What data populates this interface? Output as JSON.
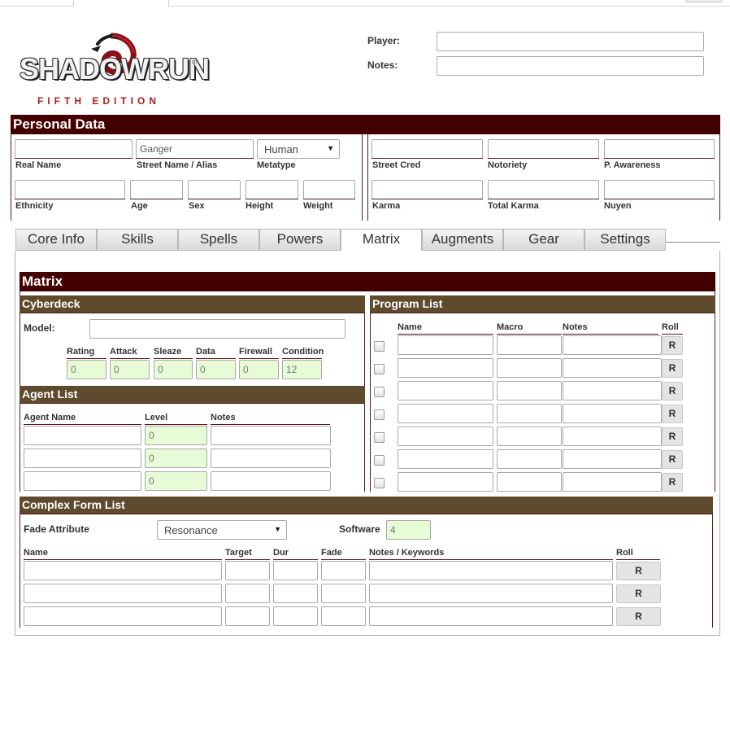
{
  "logo": {
    "word": "SHADOWRUN",
    "registered": "®",
    "subtitle": "FIFTH EDITION"
  },
  "header": {
    "player_label": "Player:",
    "player_value": "",
    "notes_label": "Notes:",
    "notes_value": ""
  },
  "personal": {
    "title": "Personal Data",
    "real_name_label": "Real Name",
    "street_name_label": "Street Name / Alias",
    "street_name_value": "Ganger",
    "metatype_label": "Metatype",
    "metatype_value": "Human",
    "street_cred_label": "Street Cred",
    "notoriety_label": "Notoriety",
    "awareness_label": "P. Awareness",
    "ethnicity_label": "Ethnicity",
    "age_label": "Age",
    "sex_label": "Sex",
    "height_label": "Height",
    "weight_label": "Weight",
    "karma_label": "Karma",
    "total_karma_label": "Total Karma",
    "nuyen_label": "Nuyen"
  },
  "tabs": [
    "Core Info",
    "Skills",
    "Spells",
    "Powers",
    "Matrix",
    "Augments",
    "Gear",
    "Settings"
  ],
  "active_tab": "Matrix",
  "matrix": {
    "title": "Matrix",
    "cyberdeck": {
      "title": "Cyberdeck",
      "model_label": "Model:",
      "stats": [
        {
          "label": "Rating",
          "value": "0"
        },
        {
          "label": "Attack",
          "value": "0"
        },
        {
          "label": "Sleaze",
          "value": "0"
        },
        {
          "label": "Data",
          "value": "0"
        },
        {
          "label": "Firewall",
          "value": "0"
        },
        {
          "label": "Condition",
          "value": "12"
        }
      ]
    },
    "agents": {
      "title": "Agent List",
      "name_label": "Agent Name",
      "level_label": "Level",
      "notes_label": "Notes",
      "levels": [
        "0",
        "0",
        "0"
      ]
    },
    "programs": {
      "title": "Program List",
      "name_label": "Name",
      "macro_label": "Macro",
      "notes_label": "Notes",
      "roll_label": "Roll",
      "roll_button": "R"
    },
    "complex_forms": {
      "title": "Complex Form List",
      "fade_attribute_label": "Fade Attribute",
      "fade_attribute_value": "Resonance",
      "software_label": "Software",
      "software_value": "4",
      "name_label": "Name",
      "target_label": "Target",
      "dur_label": "Dur",
      "fade_label": "Fade",
      "notes_label": "Notes / Keywords",
      "roll_label": "Roll",
      "roll_button": "R"
    }
  }
}
